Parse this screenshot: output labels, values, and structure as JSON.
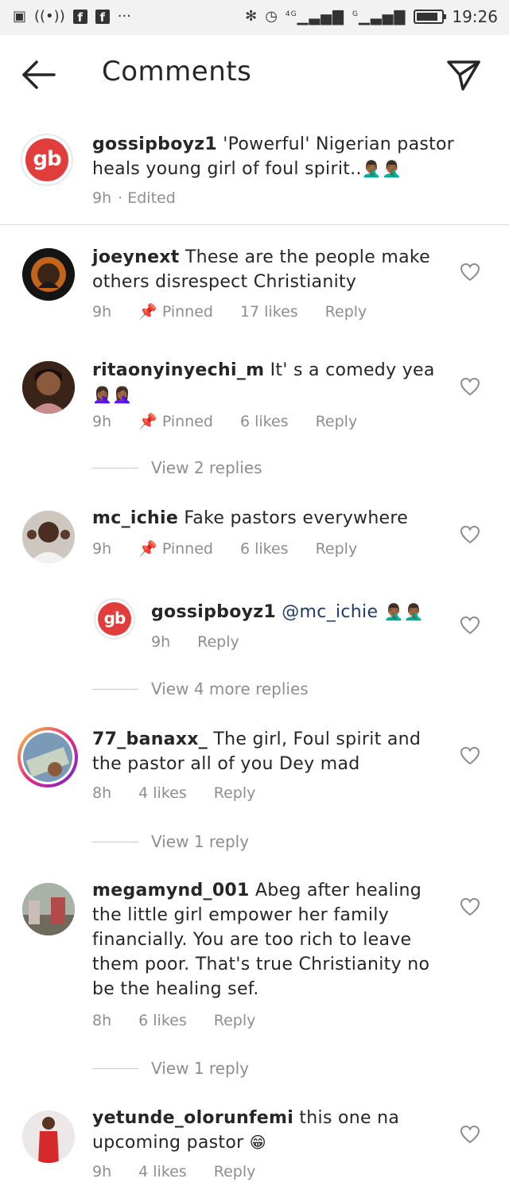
{
  "status_bar": {
    "network": "4G",
    "network2": "G",
    "time": "19:26",
    "battery_level": 0.85
  },
  "header": {
    "title": "Comments"
  },
  "icons": {
    "back": "arrow-left-icon",
    "send": "paper-plane-icon",
    "like": "heart-icon",
    "pin": "pin-icon"
  },
  "colors": {
    "gb_brand": "#e23d3d",
    "mention": "#1c3b6e",
    "meta": "#8e8e8e"
  },
  "caption": {
    "user": "gossipboyz1",
    "text": " 'Powerful' Nigerian pastor heals young girl of foul spirit..",
    "emoji": "🤦🏾‍♂️🤦🏾‍♂️",
    "time": "9h",
    "edited": "· Edited"
  },
  "comments": [
    {
      "user": "joeynext",
      "text": " These are the people make others  disrespect Christianity",
      "time": "9h",
      "pinned": "Pinned",
      "likes": "17 likes",
      "reply": "Reply"
    },
    {
      "user": "ritaonyinyechi_m",
      "text": " It' s a comedy yea",
      "emoji": "🤦🏾‍♀️🤦🏾‍♀️",
      "time": "9h",
      "pinned": "Pinned",
      "likes": "6 likes",
      "reply": "Reply",
      "view_replies": "View 2 replies"
    },
    {
      "user": "mc_ichie",
      "text": " Fake pastors everywhere",
      "time": "9h",
      "pinned": "Pinned",
      "likes": "6 likes",
      "reply": "Reply",
      "nested": {
        "user": "gossipboyz1",
        "mention": " @mc_ichie",
        "emoji": "🤦🏾‍♂️🤦🏾‍♂️",
        "time": "9h",
        "reply": "Reply"
      },
      "view_replies": "View 4 more replies"
    },
    {
      "user": "77_banaxx_",
      "text": " The girl, Foul spirit and the pastor all of you Dey mad",
      "time": "8h",
      "likes": "4 likes",
      "reply": "Reply",
      "view_replies": "View 1 reply"
    },
    {
      "user": "megamynd_001",
      "text": " Abeg after healing the little girl empower her family financially. You are too rich to leave them poor. That's true Christianity no be the healing sef.",
      "time": "8h",
      "likes": "6 likes",
      "reply": "Reply",
      "view_replies": "View 1 reply"
    },
    {
      "user": "yetunde_olorunfemi",
      "text": " this one na upcoming pastor",
      "emoji": "😁",
      "time": "9h",
      "likes": "4 likes",
      "reply": "Reply"
    }
  ]
}
